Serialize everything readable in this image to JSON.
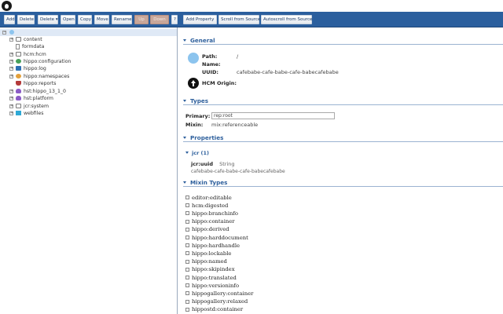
{
  "toolbar": {
    "buttons": [
      {
        "label": "Add",
        "enabled": true
      },
      {
        "label": "Delete",
        "enabled": true
      },
      {
        "label": "Delete ▾",
        "enabled": true
      },
      {
        "label": "Open",
        "enabled": true
      },
      {
        "label": "Copy",
        "enabled": true
      },
      {
        "label": "Move",
        "enabled": true
      },
      {
        "label": "Rename",
        "enabled": true
      },
      {
        "label": "Up",
        "enabled": false
      },
      {
        "label": "Down",
        "enabled": false
      },
      {
        "label": "?",
        "enabled": true
      },
      {
        "label": "Add Property",
        "enabled": true
      },
      {
        "label": "Scroll from Source",
        "enabled": true
      },
      {
        "label": "Autoscroll from Source",
        "enabled": true
      }
    ]
  },
  "tree": {
    "items": [
      {
        "label": "content",
        "icon": "folder-icon",
        "expander": "+"
      },
      {
        "label": "formdata",
        "icon": "document-icon",
        "expander": ""
      },
      {
        "label": "hcm:hcm",
        "icon": "folder-icon",
        "expander": "+"
      },
      {
        "label": "hippo:configuration",
        "icon": "gear-icon",
        "expander": "+"
      },
      {
        "label": "hippo:log",
        "icon": "log-icon",
        "expander": "+"
      },
      {
        "label": "hippo:namespaces",
        "icon": "namespace-icon",
        "expander": "+"
      },
      {
        "label": "hippo:reports",
        "icon": "reports-icon",
        "expander": ""
      },
      {
        "label": "hst:hippo_13_1_0",
        "icon": "cloud-icon",
        "expander": "+"
      },
      {
        "label": "hst:platform",
        "icon": "cloud-icon",
        "expander": "+"
      },
      {
        "label": "jcr:system",
        "icon": "folder-icon",
        "expander": "+"
      },
      {
        "label": "webfiles",
        "icon": "cube-icon",
        "expander": "+"
      }
    ]
  },
  "general": {
    "title": "General",
    "path_label": "Path:",
    "path_value": "/",
    "name_label": "Name:",
    "name_value": "",
    "uuid_label": "UUID:",
    "uuid_value": "cafebabe-cafe-babe-cafe-babecafebabe",
    "hcm_origin_label": "HCM Origin:"
  },
  "types": {
    "title": "Types",
    "primary_label": "Primary:",
    "primary_value": "rep:root",
    "mixin_label": "Mixin:",
    "mixin_value": "mix:referenceable"
  },
  "properties": {
    "title": "Properties",
    "group": "jcr (1)",
    "prop_name": "jcr:uuid",
    "prop_type": "String",
    "prop_value": "cafebabe-cafe-babe-cafe-babecafebabe"
  },
  "mixins": {
    "title": "Mixin Types",
    "items": [
      "editor:editable",
      "hcm:digested",
      "hippo:branchinfo",
      "hippo:container",
      "hippo:derived",
      "hippo:harddocument",
      "hippo:hardhandle",
      "hippo:lockable",
      "hippo:named",
      "hippo:skipindex",
      "hippo:translated",
      "hippo:versioninfo",
      "hippogallery:container",
      "hippogallery:relaxed",
      "hippostd:container"
    ]
  },
  "colors": {
    "toolbar": "#2b5f9e",
    "section_title": "#2d5f9c",
    "tree_selected": "#dfe9f6"
  }
}
